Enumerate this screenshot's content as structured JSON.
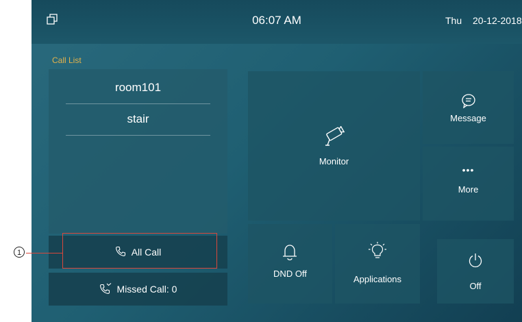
{
  "status_bar": {
    "time": "06:07 AM",
    "day": "Thu",
    "date": "20-12-2018"
  },
  "call_list": {
    "title": "Call List",
    "contacts": [
      "room101",
      "stair"
    ],
    "all_call_label": "All Call",
    "missed_call_label": "Missed Call: 0"
  },
  "tiles": {
    "monitor": "Monitor",
    "message": "Message",
    "more": "More",
    "more_dots": "•••",
    "dnd": "DND Off",
    "applications": "Applications",
    "power": "Off"
  },
  "annotation": {
    "number": "1"
  },
  "icons": [
    "window-icon",
    "camera-icon",
    "chat-icon",
    "bell-icon",
    "bulb-icon",
    "power-icon",
    "phone-icon",
    "missed-call-icon"
  ],
  "colors": {
    "accent": "#e3b24b",
    "annotation": "#d9473b"
  }
}
